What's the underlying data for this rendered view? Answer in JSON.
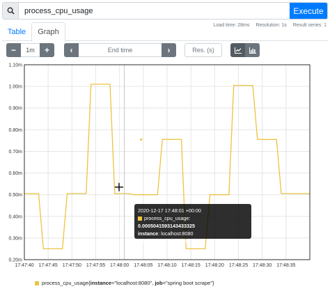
{
  "search": {
    "value": "process_cpu_usage",
    "execute_label": "Execute"
  },
  "tabs": [
    {
      "label": "Table"
    },
    {
      "label": "Graph"
    }
  ],
  "stats": {
    "load_time": "Load time: 28ms",
    "resolution": "Resolution: 1s",
    "result_series": "Result series: 1"
  },
  "controls": {
    "range_minus": "−",
    "range_value": "1m",
    "range_plus": "+",
    "end_prev": "‹",
    "end_placeholder": "End time",
    "end_next": "›",
    "res_placeholder": "Res. (s)"
  },
  "chart_data": {
    "type": "line",
    "xlabel": "",
    "ylabel": "",
    "y_ticks": [
      "0.20m",
      "0.30m",
      "0.40m",
      "0.50m",
      "0.60m",
      "0.70m",
      "0.80m",
      "0.90m",
      "1.00m",
      "1.10m"
    ],
    "x_ticks": [
      "17:47:40",
      "17:47:45",
      "17:47:50",
      "17:47:55",
      "17:48:00",
      "17:48:05",
      "17:48:10",
      "17:48:15",
      "17:48:20",
      "17:48:25",
      "17:48:30",
      "17:48:35"
    ],
    "ylim": [
      0.2,
      1.1
    ],
    "xlim": [
      0,
      60
    ],
    "grid": true,
    "series": [
      {
        "name": "process_cpu_usage{instance=\"localhost:8080\", job=\"spring boot scrape\"}",
        "color": "#edc240",
        "x": [
          0,
          3,
          4,
          8,
          9,
          13,
          14,
          18,
          19,
          22,
          23,
          28,
          29,
          33,
          34,
          38,
          39,
          43,
          44,
          48,
          49,
          53,
          54,
          57,
          58,
          60
        ],
        "y": [
          0.505,
          0.505,
          0.25,
          0.25,
          0.505,
          0.505,
          1.01,
          1.01,
          0.505,
          0.505,
          0.5,
          0.5,
          0.755,
          0.755,
          0.25,
          0.25,
          0.5,
          0.5,
          1.005,
          1.005,
          0.755,
          0.755,
          0.505,
          0.505,
          0.505,
          0.505
        ]
      }
    ],
    "cursor_x": 21
  },
  "tooltip": {
    "time": "2020-12-17 17:48:01 +00:00",
    "metric": "process_cpu_usage:",
    "value": "0.0005041593143433325",
    "instance_key": "instance",
    "instance_val": ": localhost:8080",
    "job_key": "job",
    "job_val": ": spring boot scrape"
  },
  "legend": {
    "prefix": "process_cpu_usage{",
    "k1": "instance",
    "v1": "=\"localhost:8080\", ",
    "k2": "job",
    "v2": "=\"spring boot scrape\"}"
  }
}
